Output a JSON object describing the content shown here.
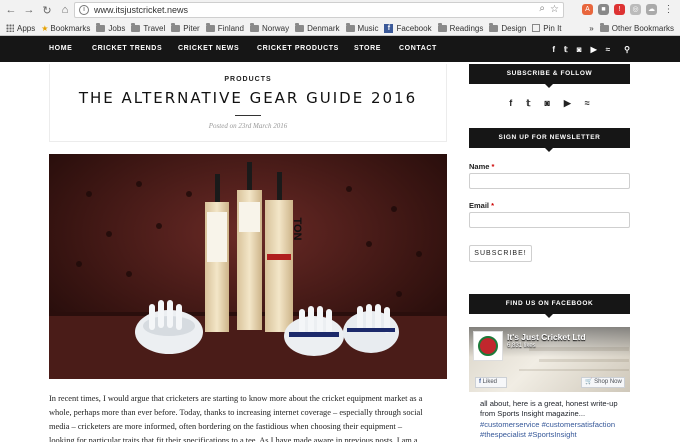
{
  "browser": {
    "url": "www.itsjustcricket.news",
    "bookmarks": [
      "Apps",
      "Bookmarks",
      "Jobs",
      "Travel",
      "Piter",
      "Finland",
      "Norway",
      "Denmark",
      "Music",
      "Facebook",
      "Readings",
      "Design",
      "Pin It"
    ],
    "more": "»",
    "other_bookmarks": "Other Bookmarks"
  },
  "nav": {
    "items": [
      "HOME",
      "CRICKET TRENDS",
      "CRICKET NEWS",
      "CRICKET PRODUCTS",
      "STORE",
      "CONTACT"
    ],
    "social_icons": [
      "facebook-icon",
      "twitter-icon",
      "instagram-icon",
      "youtube-icon",
      "rss-icon",
      "search-icon"
    ]
  },
  "post": {
    "category": "PRODUCTS",
    "title": "THE ALTERNATIVE GEAR GUIDE 2016",
    "posted": "Posted on 23rd March 2016",
    "body": [
      "In recent times, I would argue that cricketers are starting to know more about the cricket equipment market as a",
      "whole, perhaps more than ever before. Today, thanks to increasing internet coverage – especially through social",
      "media – cricketers are more informed, often bordering on the fastidious when choosing their equipment –",
      "looking for particular traits that fit their specifications to a tee. As I have made aware in previous posts, I am a"
    ]
  },
  "photo": {
    "bat_labels": [
      "TON"
    ]
  },
  "sidebar": {
    "subscribe_title": "SUBSCRIBE & FOLLOW",
    "newsletter_title": "SIGN UP FOR NEWSLETTER",
    "name_label": "Name",
    "email_label": "Email",
    "required_mark": "*",
    "subscribe_button": "SUBSCRIBE!",
    "facebook_title": "FIND US ON FACEBOOK",
    "fb": {
      "page_name": "It's Just Cricket Ltd",
      "likes": "6,831 likes",
      "liked_button": "Liked",
      "shop_button": "Shop Now",
      "post_lines": [
        "all about, here is a great, honest write-up",
        "from Sports Insight magazine..."
      ],
      "tag_lines": [
        "#customerservice #customersatisfaction",
        "#thespecialist #SportsInsight"
      ]
    }
  },
  "colors": {
    "nav_bg": "#161616",
    "required": "#cc0000",
    "fb_blue": "#3b5998"
  }
}
